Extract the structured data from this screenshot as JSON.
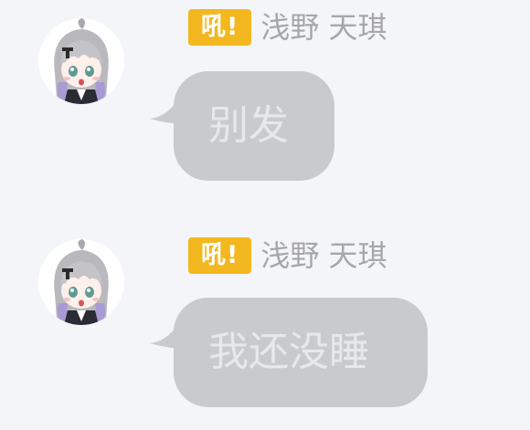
{
  "messages": [
    {
      "badge": "吼!",
      "sender": "浅野 天琪",
      "text": "别发"
    },
    {
      "badge": "吼!",
      "sender": "浅野 天琪",
      "text": "我还没睡"
    }
  ],
  "colors": {
    "background": "#f4f5f9",
    "badge": "#f3b81f",
    "bubble": "#c9cacd",
    "bubble_text": "#e7e8eb",
    "sender_text": "#a7a7a7"
  },
  "icons": {
    "avatar": "anime-girl-avatar"
  }
}
